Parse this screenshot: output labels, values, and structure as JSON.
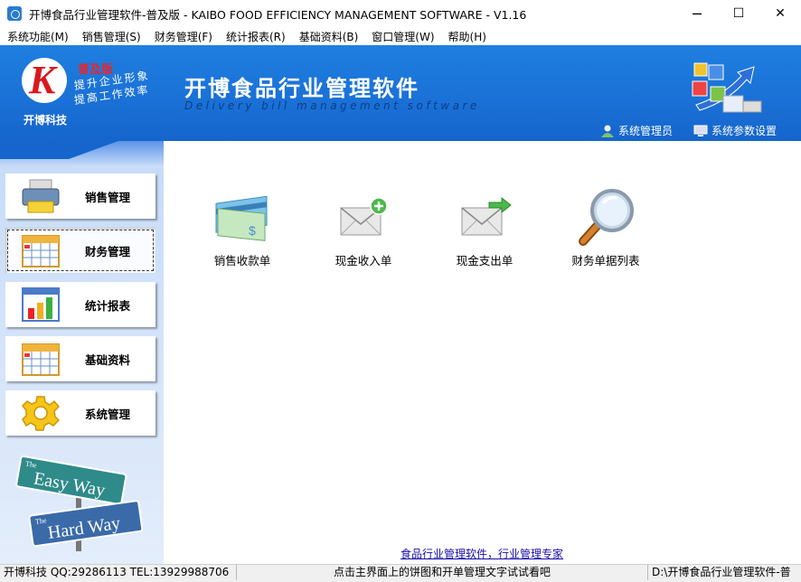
{
  "window": {
    "title": "开博食品行业管理软件-普及版 - KAIBO FOOD EFFICIENCY MANAGEMENT SOFTWARE - V1.16",
    "minimize": "─",
    "maximize": "☐",
    "close": "✕"
  },
  "menu": [
    "系统功能(M)",
    "销售管理(S)",
    "财务管理(F)",
    "统计报表(R)",
    "基础资料(B)",
    "窗口管理(W)",
    "帮助(H)"
  ],
  "banner": {
    "edition": "普及版",
    "slogan1": "提升企业形象",
    "slogan2": "提高工作效率",
    "company": "开博科技",
    "app_title": "开博食品行业管理软件",
    "app_subtitle": "Delivery bill management software",
    "admin_link": "系统管理员",
    "settings_link": "系统参数设置"
  },
  "sidebar": {
    "items": [
      {
        "label": "销售管理",
        "icon": "printer-icon"
      },
      {
        "label": "财务管理",
        "icon": "calendar-icon"
      },
      {
        "label": "统计报表",
        "icon": "bar-chart-icon"
      },
      {
        "label": "基础资料",
        "icon": "calendar-icon"
      },
      {
        "label": "系统管理",
        "icon": "gear-icon"
      }
    ],
    "active_index": 1,
    "sign_top_small": "The",
    "sign_top": "Easy Way",
    "sign_bottom_small": "The",
    "sign_bottom": "Hard Way"
  },
  "main": {
    "items": [
      {
        "label": "销售收款单",
        "icon": "payment-card-icon"
      },
      {
        "label": "现金收入单",
        "icon": "envelope-add-icon"
      },
      {
        "label": "现金支出单",
        "icon": "envelope-send-icon"
      },
      {
        "label": "财务单据列表",
        "icon": "magnifier-icon"
      }
    ],
    "bottom_link": "食品行业管理软件，行业管理专家"
  },
  "status": {
    "contact": "开博科技 QQ:29286113 TEL:13929988706",
    "hint": "点击主界面上的饼图和开单管理文字试试看吧",
    "path": "D:\\开博食品行业管理软件-普"
  },
  "colors": {
    "banner_blue": "#1a70d6",
    "logo_red": "#d8191f",
    "link_blue": "#1a0dab"
  }
}
